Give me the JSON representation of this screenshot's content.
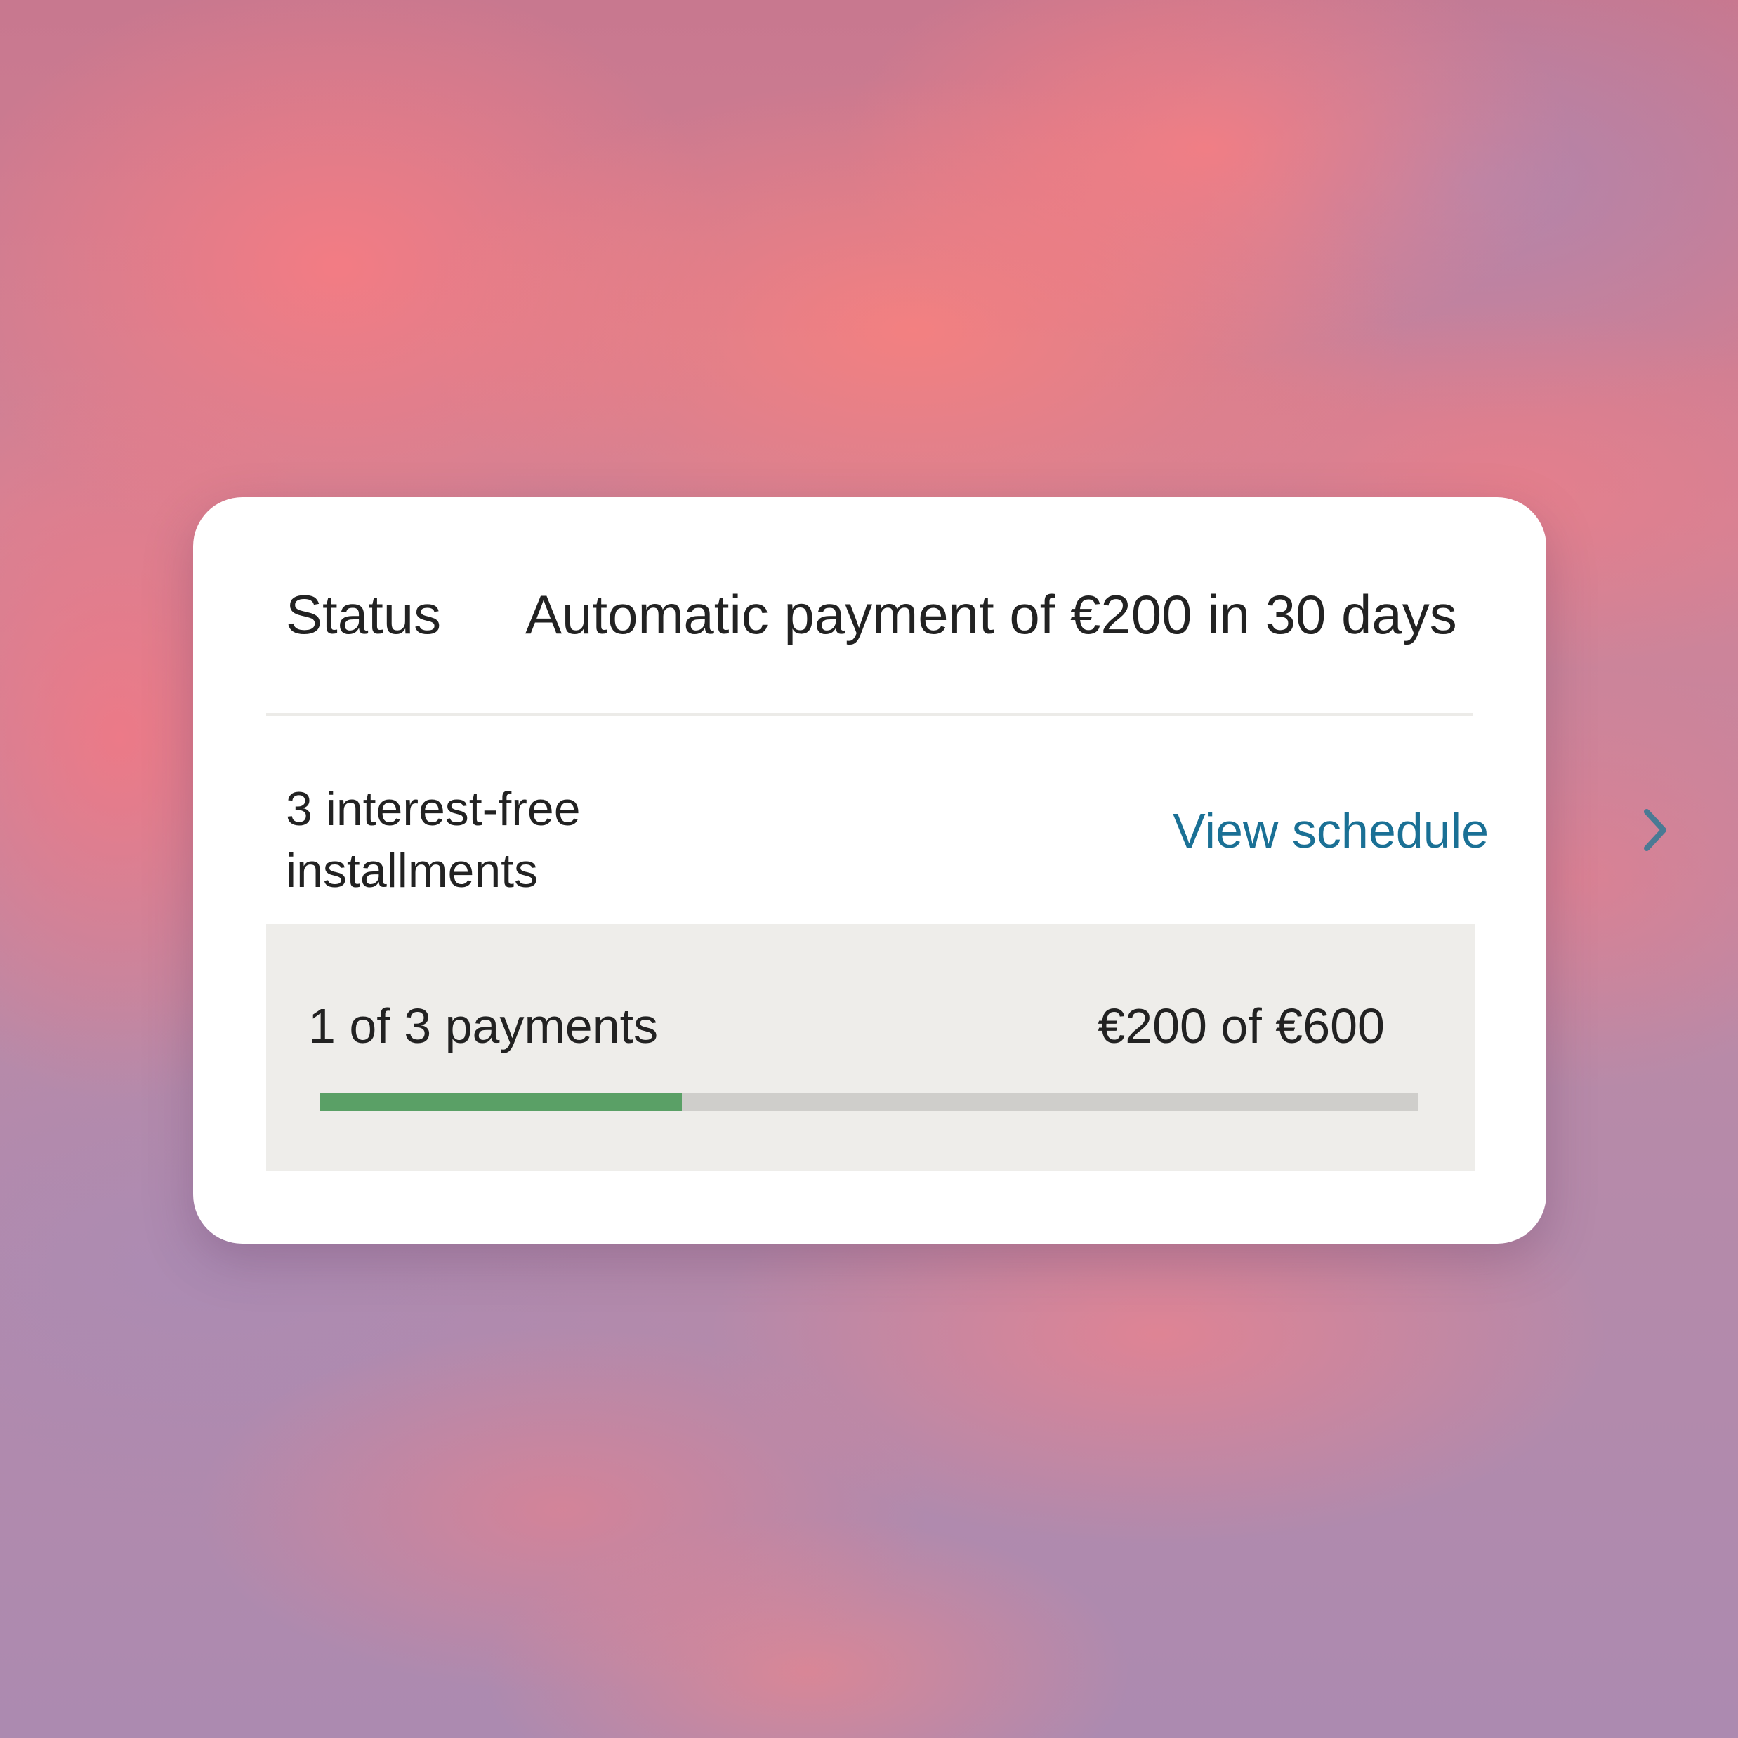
{
  "status": {
    "label": "Status",
    "value": "Automatic payment of €200 in 30 days"
  },
  "plan": {
    "label": "3 interest-free installments",
    "view_schedule_label": "View schedule",
    "chevron_icon": "chevron-right-icon"
  },
  "progress": {
    "payments_label": "1 of 3 payments",
    "amount_label": "€200 of €600",
    "paid_amount": 200,
    "total_amount": 600,
    "fill_fraction": 0.33
  },
  "colors": {
    "card_background": "#ffffff",
    "panel_background": "#eeedea",
    "link": "#1a7095",
    "chevron": "#4a7a94",
    "progress_fill": "#5aa066",
    "progress_track": "#cfcecb",
    "text": "#222222"
  }
}
